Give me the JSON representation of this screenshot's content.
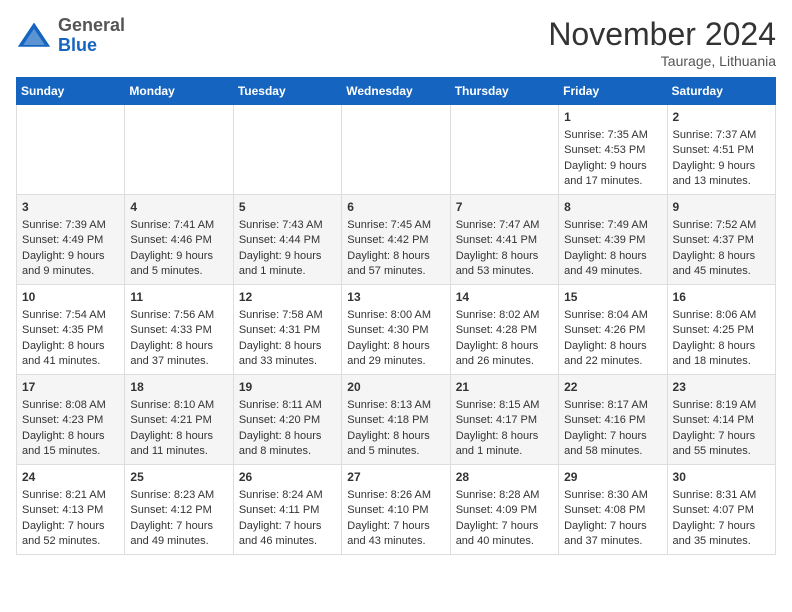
{
  "header": {
    "logo_general": "General",
    "logo_blue": "Blue",
    "month_title": "November 2024",
    "location": "Taurage, Lithuania"
  },
  "weekdays": [
    "Sunday",
    "Monday",
    "Tuesday",
    "Wednesday",
    "Thursday",
    "Friday",
    "Saturday"
  ],
  "weeks": [
    [
      {
        "day": "",
        "sunrise": "",
        "sunset": "",
        "daylight": ""
      },
      {
        "day": "",
        "sunrise": "",
        "sunset": "",
        "daylight": ""
      },
      {
        "day": "",
        "sunrise": "",
        "sunset": "",
        "daylight": ""
      },
      {
        "day": "",
        "sunrise": "",
        "sunset": "",
        "daylight": ""
      },
      {
        "day": "",
        "sunrise": "",
        "sunset": "",
        "daylight": ""
      },
      {
        "day": "1",
        "sunrise": "Sunrise: 7:35 AM",
        "sunset": "Sunset: 4:53 PM",
        "daylight": "Daylight: 9 hours and 17 minutes."
      },
      {
        "day": "2",
        "sunrise": "Sunrise: 7:37 AM",
        "sunset": "Sunset: 4:51 PM",
        "daylight": "Daylight: 9 hours and 13 minutes."
      }
    ],
    [
      {
        "day": "3",
        "sunrise": "Sunrise: 7:39 AM",
        "sunset": "Sunset: 4:49 PM",
        "daylight": "Daylight: 9 hours and 9 minutes."
      },
      {
        "day": "4",
        "sunrise": "Sunrise: 7:41 AM",
        "sunset": "Sunset: 4:46 PM",
        "daylight": "Daylight: 9 hours and 5 minutes."
      },
      {
        "day": "5",
        "sunrise": "Sunrise: 7:43 AM",
        "sunset": "Sunset: 4:44 PM",
        "daylight": "Daylight: 9 hours and 1 minute."
      },
      {
        "day": "6",
        "sunrise": "Sunrise: 7:45 AM",
        "sunset": "Sunset: 4:42 PM",
        "daylight": "Daylight: 8 hours and 57 minutes."
      },
      {
        "day": "7",
        "sunrise": "Sunrise: 7:47 AM",
        "sunset": "Sunset: 4:41 PM",
        "daylight": "Daylight: 8 hours and 53 minutes."
      },
      {
        "day": "8",
        "sunrise": "Sunrise: 7:49 AM",
        "sunset": "Sunset: 4:39 PM",
        "daylight": "Daylight: 8 hours and 49 minutes."
      },
      {
        "day": "9",
        "sunrise": "Sunrise: 7:52 AM",
        "sunset": "Sunset: 4:37 PM",
        "daylight": "Daylight: 8 hours and 45 minutes."
      }
    ],
    [
      {
        "day": "10",
        "sunrise": "Sunrise: 7:54 AM",
        "sunset": "Sunset: 4:35 PM",
        "daylight": "Daylight: 8 hours and 41 minutes."
      },
      {
        "day": "11",
        "sunrise": "Sunrise: 7:56 AM",
        "sunset": "Sunset: 4:33 PM",
        "daylight": "Daylight: 8 hours and 37 minutes."
      },
      {
        "day": "12",
        "sunrise": "Sunrise: 7:58 AM",
        "sunset": "Sunset: 4:31 PM",
        "daylight": "Daylight: 8 hours and 33 minutes."
      },
      {
        "day": "13",
        "sunrise": "Sunrise: 8:00 AM",
        "sunset": "Sunset: 4:30 PM",
        "daylight": "Daylight: 8 hours and 29 minutes."
      },
      {
        "day": "14",
        "sunrise": "Sunrise: 8:02 AM",
        "sunset": "Sunset: 4:28 PM",
        "daylight": "Daylight: 8 hours and 26 minutes."
      },
      {
        "day": "15",
        "sunrise": "Sunrise: 8:04 AM",
        "sunset": "Sunset: 4:26 PM",
        "daylight": "Daylight: 8 hours and 22 minutes."
      },
      {
        "day": "16",
        "sunrise": "Sunrise: 8:06 AM",
        "sunset": "Sunset: 4:25 PM",
        "daylight": "Daylight: 8 hours and 18 minutes."
      }
    ],
    [
      {
        "day": "17",
        "sunrise": "Sunrise: 8:08 AM",
        "sunset": "Sunset: 4:23 PM",
        "daylight": "Daylight: 8 hours and 15 minutes."
      },
      {
        "day": "18",
        "sunrise": "Sunrise: 8:10 AM",
        "sunset": "Sunset: 4:21 PM",
        "daylight": "Daylight: 8 hours and 11 minutes."
      },
      {
        "day": "19",
        "sunrise": "Sunrise: 8:11 AM",
        "sunset": "Sunset: 4:20 PM",
        "daylight": "Daylight: 8 hours and 8 minutes."
      },
      {
        "day": "20",
        "sunrise": "Sunrise: 8:13 AM",
        "sunset": "Sunset: 4:18 PM",
        "daylight": "Daylight: 8 hours and 5 minutes."
      },
      {
        "day": "21",
        "sunrise": "Sunrise: 8:15 AM",
        "sunset": "Sunset: 4:17 PM",
        "daylight": "Daylight: 8 hours and 1 minute."
      },
      {
        "day": "22",
        "sunrise": "Sunrise: 8:17 AM",
        "sunset": "Sunset: 4:16 PM",
        "daylight": "Daylight: 7 hours and 58 minutes."
      },
      {
        "day": "23",
        "sunrise": "Sunrise: 8:19 AM",
        "sunset": "Sunset: 4:14 PM",
        "daylight": "Daylight: 7 hours and 55 minutes."
      }
    ],
    [
      {
        "day": "24",
        "sunrise": "Sunrise: 8:21 AM",
        "sunset": "Sunset: 4:13 PM",
        "daylight": "Daylight: 7 hours and 52 minutes."
      },
      {
        "day": "25",
        "sunrise": "Sunrise: 8:23 AM",
        "sunset": "Sunset: 4:12 PM",
        "daylight": "Daylight: 7 hours and 49 minutes."
      },
      {
        "day": "26",
        "sunrise": "Sunrise: 8:24 AM",
        "sunset": "Sunset: 4:11 PM",
        "daylight": "Daylight: 7 hours and 46 minutes."
      },
      {
        "day": "27",
        "sunrise": "Sunrise: 8:26 AM",
        "sunset": "Sunset: 4:10 PM",
        "daylight": "Daylight: 7 hours and 43 minutes."
      },
      {
        "day": "28",
        "sunrise": "Sunrise: 8:28 AM",
        "sunset": "Sunset: 4:09 PM",
        "daylight": "Daylight: 7 hours and 40 minutes."
      },
      {
        "day": "29",
        "sunrise": "Sunrise: 8:30 AM",
        "sunset": "Sunset: 4:08 PM",
        "daylight": "Daylight: 7 hours and 37 minutes."
      },
      {
        "day": "30",
        "sunrise": "Sunrise: 8:31 AM",
        "sunset": "Sunset: 4:07 PM",
        "daylight": "Daylight: 7 hours and 35 minutes."
      }
    ]
  ]
}
